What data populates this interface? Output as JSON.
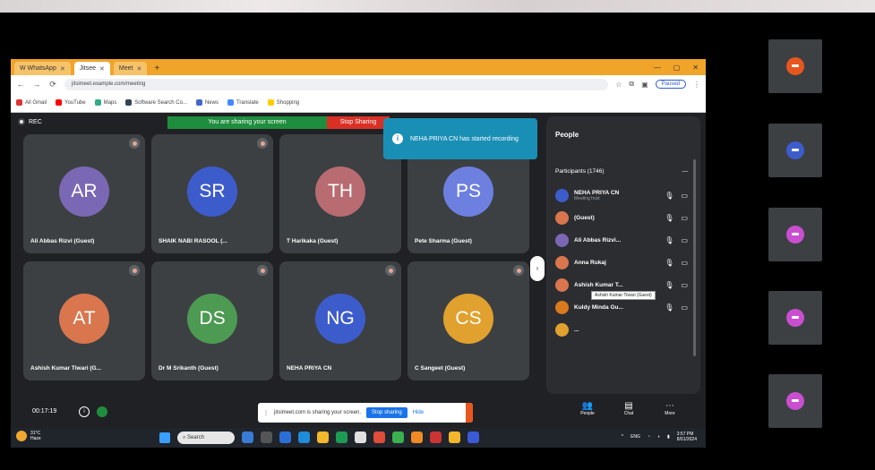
{
  "browser": {
    "tabs": [
      {
        "label": "W WhatsApp",
        "active": false
      },
      {
        "label": "Jitsee",
        "active": true
      },
      {
        "label": "Meet",
        "active": false
      }
    ],
    "address": "jitsimeet.example.com/meeting",
    "profile_button": "Paused",
    "bookmarks": [
      "All Gmail",
      "YouTube",
      "Maps",
      "Software Search Co...",
      "News",
      "Translate",
      "Shopping"
    ]
  },
  "meeting": {
    "rec_label": "REC",
    "sharing_banner": "You are sharing your screen",
    "stop_sharing": "Stop Sharing",
    "toast": "NEHA PRIYA CN has started recording",
    "participants": [
      {
        "initials": "AR",
        "name": "Ali Abbas Rizvi (Guest)",
        "color": "#7b68b5"
      },
      {
        "initials": "SR",
        "name": "SHAIK NABI RASOOL (...",
        "color": "#3d5ccc"
      },
      {
        "initials": "TH",
        "name": "T Harikaka (Guest)",
        "color": "#b86b70"
      },
      {
        "initials": "PS",
        "name": "Pete Sharma (Guest)",
        "color": "#6d80e0"
      },
      {
        "initials": "AT",
        "name": "Ashish Kumar Tiwari (G...",
        "color": "#d9764d"
      },
      {
        "initials": "DS",
        "name": "Dr M Srikanth (Guest)",
        "color": "#4d9a52"
      },
      {
        "initials": "NG",
        "name": "NEHA PRIYA CN",
        "color": "#3d5ccc"
      },
      {
        "initials": "CS",
        "name": "C Sangeet (Guest)",
        "color": "#e0a12e"
      }
    ],
    "people_panel": {
      "title": "People",
      "section_label": "Participants (1746)",
      "more": "—",
      "list": [
        {
          "name": "NEHA PRIYA CN",
          "sub": "Meeting host",
          "color": "#3d5ccc"
        },
        {
          "name": "(Guest)",
          "sub": "",
          "color": "#d9764d"
        },
        {
          "name": "Ali Abbas Rizvi...",
          "sub": "",
          "color": "#7b68b5"
        },
        {
          "name": "Anna Rukaj",
          "sub": "",
          "color": "#d9764d"
        },
        {
          "name": "Ashish Kumar T...",
          "sub": "",
          "color": "#d9764d"
        },
        {
          "name": "Kuldy Minda Gu...",
          "sub": "",
          "color": "#d97a1e"
        },
        {
          "name": "...",
          "sub": "",
          "color": "#e0a12e"
        }
      ],
      "tooltip": "Ashish Kumar Tiwari (Guest)"
    },
    "bottom": {
      "time": "00:17:19",
      "share_popup": "jitsimeet.com is sharing your screen.",
      "share_stop": "Stop sharing",
      "share_hide": "Hide",
      "controls": [
        "People",
        "Chat",
        "More"
      ]
    }
  },
  "taskbar": {
    "weather_temp": "31°C",
    "weather_desc": "Haze",
    "search": "Search",
    "time": "3:57 PM",
    "date": "8/01/2024",
    "lang": "ENG"
  },
  "thumbnails": [
    "#e8561f",
    "#3d5ccc",
    "#c94fd0",
    "#c94fd0",
    "#c94fd0"
  ]
}
